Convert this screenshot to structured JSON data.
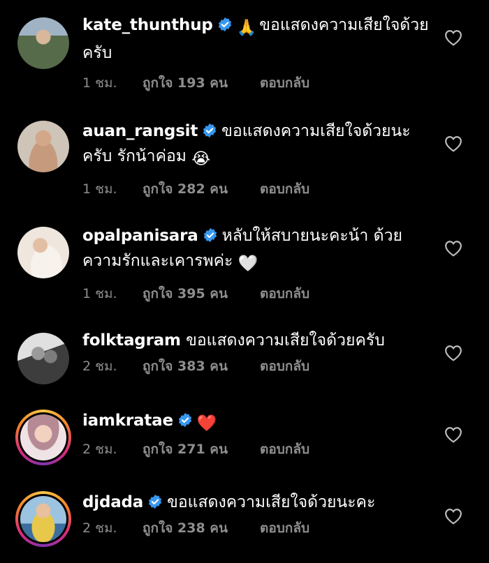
{
  "comments": [
    {
      "username": "kate_thunthup",
      "verified": true,
      "emoji": "🙏",
      "text": "ขอแสดงความเสียใจด้วยครับ",
      "time": "1 ชม.",
      "likes": "ถูกใจ 193 คน",
      "reply": "ตอบกลับ",
      "avatar_colors": [
        "#556b4a",
        "#2b2f27"
      ],
      "story_ring": false
    },
    {
      "username": "auan_rangsit",
      "verified": true,
      "text": "ขอแสดงความเสียใจด้วยนะครับ รักน้าค่อม",
      "emoji_end": "😭",
      "time": "1 ชม.",
      "likes": "ถูกใจ 282 คน",
      "reply": "ตอบกลับ",
      "avatar_colors": [
        "#c9b6a2",
        "#3a3330"
      ],
      "story_ring": false
    },
    {
      "username": "opalpanisara",
      "verified": true,
      "text": "หลับให้สบายนะคะน้า ด้วยความรักและเคารพค่ะ",
      "emoji_end": "🤍",
      "time": "1 ชม.",
      "likes": "ถูกใจ 395 คน",
      "reply": "ตอบกลับ",
      "avatar_colors": [
        "#efe6de",
        "#b58a6e"
      ],
      "story_ring": false
    },
    {
      "username": "folktagram",
      "verified": false,
      "text": "ขอแสดงความเสียใจด้วยครับ",
      "time": "2 ชม.",
      "likes": "ถูกใจ 383 คน",
      "reply": "ตอบกลับ",
      "avatar_colors": [
        "#d8d8d8",
        "#3d3d3d"
      ],
      "story_ring": false
    },
    {
      "username": "iamkratae",
      "verified": true,
      "emoji_end": "❤️",
      "text": "",
      "time": "2 ชม.",
      "likes": "ถูกใจ 271 คน",
      "reply": "ตอบกลับ",
      "avatar_colors": [
        "#c9a3ae",
        "#f0e3e6"
      ],
      "story_ring": true
    },
    {
      "username": "djdada",
      "verified": true,
      "text": "ขอแสดงความเสียใจด้วยนะคะ",
      "time": "2 ชม.",
      "likes": "ถูกใจ 238 คน",
      "reply": "ตอบกลับ",
      "avatar_colors": [
        "#e8c84a",
        "#7aa6c9"
      ],
      "story_ring": true
    }
  ],
  "colors": {
    "background": "#000000",
    "text": "#ffffff",
    "meta": "#8e8e8e",
    "verified": "#3797f0"
  }
}
